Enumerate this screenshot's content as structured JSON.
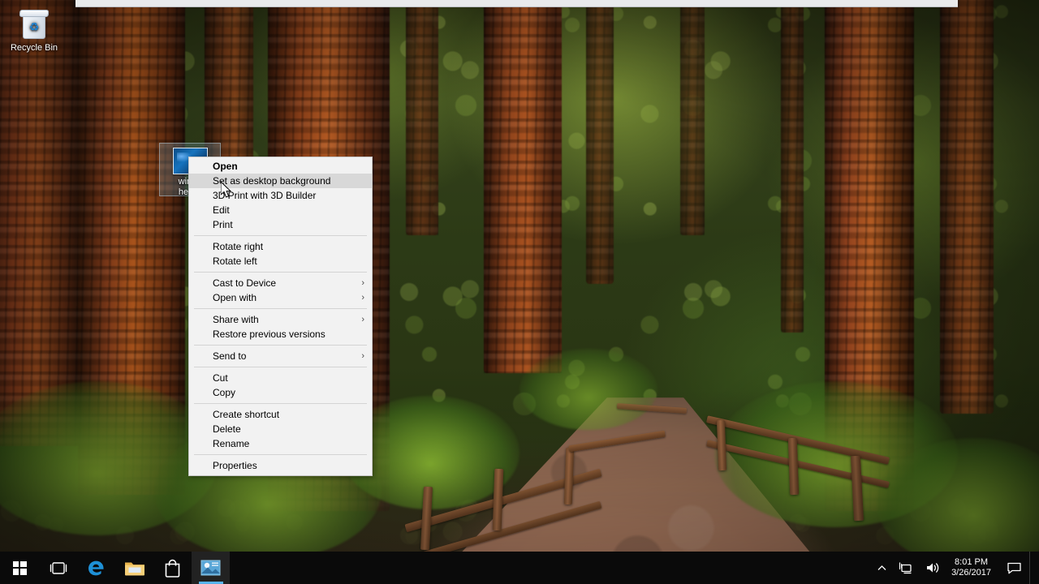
{
  "desktop": {
    "icons": [
      {
        "name": "recycle-bin",
        "label": "Recycle Bin"
      },
      {
        "name": "image-file",
        "label_line1": "windo",
        "label_line2": "hero_"
      }
    ]
  },
  "context_menu": {
    "items": [
      {
        "label": "Open",
        "bold": true,
        "highlighted": false,
        "submenu": false,
        "separator_after": false
      },
      {
        "label": "Set as desktop background",
        "bold": false,
        "highlighted": true,
        "submenu": false,
        "separator_after": false
      },
      {
        "label": "3D Print with 3D Builder",
        "bold": false,
        "highlighted": false,
        "submenu": false,
        "separator_after": false
      },
      {
        "label": "Edit",
        "bold": false,
        "highlighted": false,
        "submenu": false,
        "separator_after": false
      },
      {
        "label": "Print",
        "bold": false,
        "highlighted": false,
        "submenu": false,
        "separator_after": true
      },
      {
        "label": "Rotate right",
        "bold": false,
        "highlighted": false,
        "submenu": false,
        "separator_after": false
      },
      {
        "label": "Rotate left",
        "bold": false,
        "highlighted": false,
        "submenu": false,
        "separator_after": true
      },
      {
        "label": "Cast to Device",
        "bold": false,
        "highlighted": false,
        "submenu": true,
        "separator_after": false
      },
      {
        "label": "Open with",
        "bold": false,
        "highlighted": false,
        "submenu": true,
        "separator_after": true
      },
      {
        "label": "Share with",
        "bold": false,
        "highlighted": false,
        "submenu": true,
        "separator_after": false
      },
      {
        "label": "Restore previous versions",
        "bold": false,
        "highlighted": false,
        "submenu": false,
        "separator_after": true
      },
      {
        "label": "Send to",
        "bold": false,
        "highlighted": false,
        "submenu": true,
        "separator_after": true
      },
      {
        "label": "Cut",
        "bold": false,
        "highlighted": false,
        "submenu": false,
        "separator_after": false
      },
      {
        "label": "Copy",
        "bold": false,
        "highlighted": false,
        "submenu": false,
        "separator_after": true
      },
      {
        "label": "Create shortcut",
        "bold": false,
        "highlighted": false,
        "submenu": false,
        "separator_after": false
      },
      {
        "label": "Delete",
        "bold": false,
        "highlighted": false,
        "submenu": false,
        "separator_after": false
      },
      {
        "label": "Rename",
        "bold": false,
        "highlighted": false,
        "submenu": false,
        "separator_after": true
      },
      {
        "label": "Properties",
        "bold": false,
        "highlighted": false,
        "submenu": false,
        "separator_after": false
      }
    ],
    "submenu_arrow": "›",
    "highlight_color": "#d8d8d8",
    "background_color": "#f2f2f2"
  },
  "taskbar": {
    "buttons": [
      {
        "name": "start-button",
        "icon": "windows-logo-icon",
        "label": "Start"
      },
      {
        "name": "task-view-button",
        "icon": "task-view-icon",
        "label": "Task View"
      },
      {
        "name": "edge-button",
        "icon": "edge-icon",
        "label": "Microsoft Edge"
      },
      {
        "name": "file-explorer-button",
        "icon": "folder-icon",
        "label": "File Explorer"
      },
      {
        "name": "store-button",
        "icon": "store-bag-icon",
        "label": "Microsoft Store"
      },
      {
        "name": "photos-button",
        "icon": "photos-icon",
        "label": "Photos",
        "active": true
      }
    ],
    "tray": {
      "show_hidden_icons": "∧",
      "network_icon": "network-icon",
      "volume_icon": "volume-icon",
      "time": "8:01 PM",
      "date": "3/26/2017",
      "action_center_icon": "action-center-icon"
    },
    "accent_color": "#59b4ec",
    "background_color": "#0a0a0a"
  }
}
